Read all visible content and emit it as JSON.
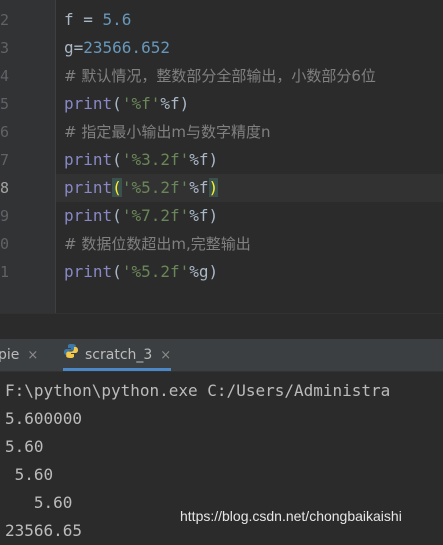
{
  "editor": {
    "line_numbers": [
      "2",
      "3",
      "4",
      "5",
      "6",
      "7",
      "8",
      "9",
      "0",
      "1"
    ],
    "current_line_index": 6,
    "lines": [
      [
        {
          "t": "f = ",
          "c": ""
        },
        {
          "t": "5.6",
          "c": "num"
        }
      ],
      [
        {
          "t": "g=",
          "c": ""
        },
        {
          "t": "23566.652",
          "c": "num"
        }
      ],
      [
        {
          "t": "# 默认情况，整数部分全部输出，小数部分6位",
          "c": "cm"
        }
      ],
      [
        {
          "t": "print",
          "c": "fn"
        },
        {
          "t": "(",
          "c": ""
        },
        {
          "t": "'%f'",
          "c": "str"
        },
        {
          "t": "%f)",
          "c": ""
        }
      ],
      [
        {
          "t": "# 指定最小输出m与数字精度n",
          "c": "cm"
        }
      ],
      [
        {
          "t": "print",
          "c": "fn"
        },
        {
          "t": "(",
          "c": ""
        },
        {
          "t": "'%3.2f'",
          "c": "str"
        },
        {
          "t": "%f)",
          "c": ""
        }
      ],
      [
        {
          "t": "print",
          "c": "fn"
        },
        {
          "t": "(",
          "c": "bm"
        },
        {
          "t": "'%5.2f'",
          "c": "str"
        },
        {
          "t": "%f",
          "c": ""
        },
        {
          "t": ")",
          "c": "bm"
        }
      ],
      [
        {
          "t": "print",
          "c": "fn"
        },
        {
          "t": "(",
          "c": ""
        },
        {
          "t": "'%7.2f'",
          "c": "str"
        },
        {
          "t": "%f)",
          "c": ""
        }
      ],
      [
        {
          "t": "# 数据位数超出m,完整输出",
          "c": "cm"
        }
      ],
      [
        {
          "t": "print",
          "c": "fn"
        },
        {
          "t": "(",
          "c": ""
        },
        {
          "t": "'%5.2f'",
          "c": "str"
        },
        {
          "t": "%g)",
          "c": ""
        }
      ]
    ]
  },
  "tabs": [
    {
      "label": "pie",
      "close": "×"
    },
    {
      "label": "scratch_3",
      "close": "×",
      "active": true
    }
  ],
  "console": {
    "lines": [
      "F:\\python\\python.exe C:/Users/Administra",
      "5.600000",
      "5.60",
      " 5.60",
      "   5.60",
      "23566.65"
    ]
  },
  "watermark": "https://blog.csdn.net/chongbaikaishi",
  "colors": {
    "background": "#2b2b2b",
    "number": "#6897bb",
    "string": "#6a8759",
    "comment": "#808080",
    "builtin": "#8888c6"
  }
}
